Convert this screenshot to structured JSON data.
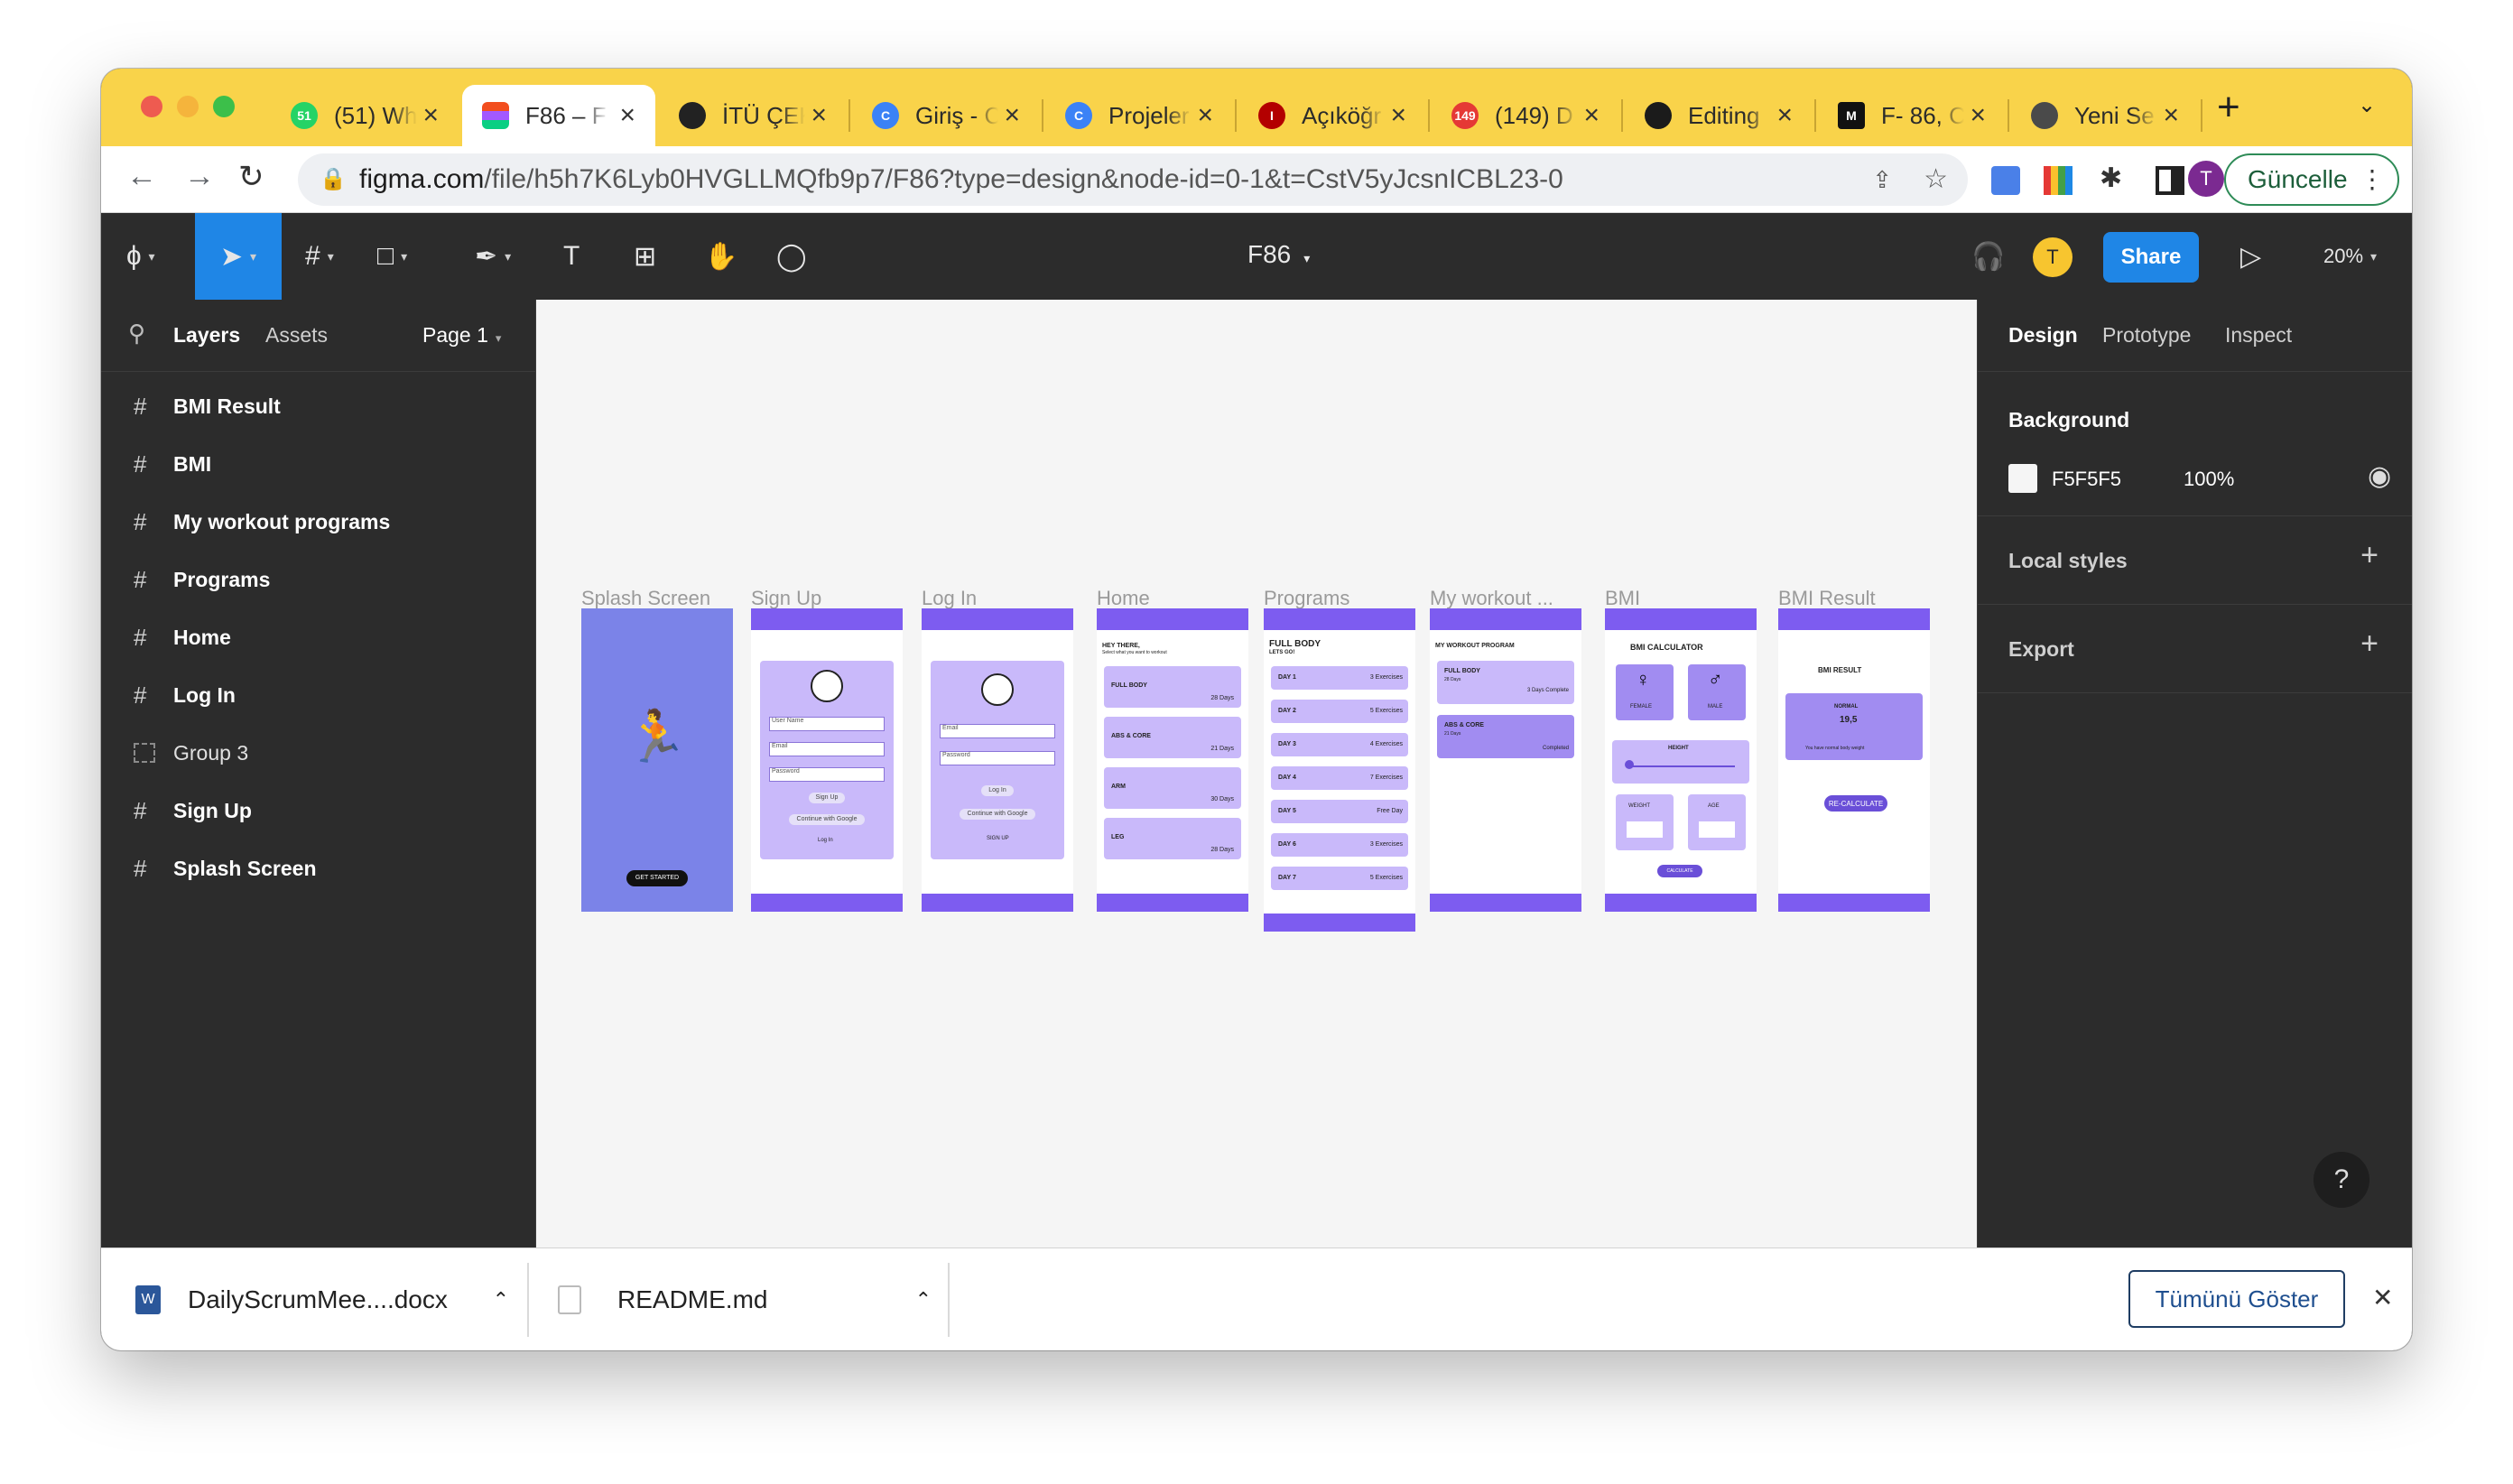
{
  "browser": {
    "tabs": [
      {
        "title": "(51) Wh",
        "icon": "whatsapp-icon",
        "color": "#25d366",
        "badge": "51"
      },
      {
        "title": "F86 – F",
        "icon": "figma-icon",
        "color": "#a259ff",
        "active": true
      },
      {
        "title": "İTÜ ÇEK",
        "icon": "globe-icon",
        "color": "#222222"
      },
      {
        "title": "Giriş - C",
        "icon": "c-logo-icon",
        "color": "#3b82f6"
      },
      {
        "title": "Projeler",
        "icon": "c-logo-icon",
        "color": "#3b82f6"
      },
      {
        "title": "Açıköğr",
        "icon": "aof-logo-icon",
        "color": "#b30000"
      },
      {
        "title": "(149) D",
        "icon": "youtube-badge-icon",
        "color": "#e53935",
        "badge": "149"
      },
      {
        "title": "Editing",
        "icon": "github-icon",
        "color": "#1b1b1b"
      },
      {
        "title": "F- 86, C",
        "icon": "miro-icon",
        "color": "#111111"
      },
      {
        "title": "Yeni Se",
        "icon": "chrome-icon",
        "color": "#4a4a4a"
      }
    ],
    "new_tab": "+",
    "url_host": "figma.com",
    "url_path": "/file/h5h7K6Lyb0HVGLLMQfb9p7/F86?type=design&node-id=0-1&t=CstV5yJcsnICBL23-0",
    "profile_initial": "T",
    "update_label": "Güncelle"
  },
  "figma": {
    "file_name": "F86",
    "user_initial": "T",
    "share_label": "Share",
    "zoom": "20%",
    "left_tabs": {
      "layers": "Layers",
      "assets": "Assets",
      "page": "Page 1"
    },
    "layers": [
      {
        "name": "BMI Result",
        "type": "frame"
      },
      {
        "name": "BMI",
        "type": "frame"
      },
      {
        "name": "My workout programs",
        "type": "frame"
      },
      {
        "name": "Programs",
        "type": "frame"
      },
      {
        "name": "Home",
        "type": "frame"
      },
      {
        "name": "Log In",
        "type": "frame"
      },
      {
        "name": "Group 3",
        "type": "group"
      },
      {
        "name": "Sign Up",
        "type": "frame"
      },
      {
        "name": "Splash Screen",
        "type": "frame"
      }
    ],
    "right_tabs": {
      "design": "Design",
      "prototype": "Prototype",
      "inspect": "Inspect"
    },
    "background": {
      "label": "Background",
      "hex": "F5F5F5",
      "opacity": "100%"
    },
    "local_styles": "Local styles",
    "export": "Export",
    "help": "?"
  },
  "frames": {
    "titles": [
      "Splash Screen",
      "Sign Up",
      "Log In",
      "Home",
      "Programs",
      "My workout ...",
      "BMI",
      "BMI Result"
    ],
    "splash_button": "GET STARTED",
    "signup": {
      "fields": [
        "User Name",
        "Email",
        "Password"
      ],
      "button": "Sign Up",
      "google": "Continue with Google",
      "link": "Log In"
    },
    "login": {
      "fields": [
        "Email",
        "Password"
      ],
      "button": "Log In",
      "google": "Continue with Google",
      "link": "SIGN UP"
    },
    "home": {
      "greeting": "HEY THERE,",
      "sub": "Select what you want to workout",
      "cards": [
        {
          "name": "FULL BODY",
          "days": "28 Days"
        },
        {
          "name": "ABS & CORE",
          "days": "21 Days"
        },
        {
          "name": "ARM",
          "days": "30 Days"
        },
        {
          "name": "LEG",
          "days": "28 Days"
        }
      ]
    },
    "programs": {
      "title": "FULL BODY",
      "sub": "LETS GO!",
      "days": [
        {
          "day": "DAY 1",
          "ex": "3 Exercises"
        },
        {
          "day": "DAY 2",
          "ex": "5 Exercises"
        },
        {
          "day": "DAY 3",
          "ex": "4 Exercises"
        },
        {
          "day": "DAY 4",
          "ex": "7 Exercises"
        },
        {
          "day": "DAY 5",
          "ex": "Free Day"
        },
        {
          "day": "DAY 6",
          "ex": "3 Exercises"
        },
        {
          "day": "DAY 7",
          "ex": "5 Exercises"
        }
      ]
    },
    "myworkout": {
      "title": "MY WORKOUT PROGRAM",
      "cards": [
        {
          "name": "FULL BODY",
          "days": "28 Days",
          "status": "3 Days Complete"
        },
        {
          "name": "ABS & CORE",
          "days": "21 Days",
          "status": "Completed"
        }
      ]
    },
    "bmi": {
      "title": "BMI CALCULATOR",
      "female": "FEMALE",
      "male": "MALE",
      "height": "HEIGHT",
      "weight": "WEIGHT",
      "age": "AGE",
      "button": "CALCULATE"
    },
    "bmiresult": {
      "title": "BMI RESULT",
      "status": "NORMAL",
      "value": "19,5",
      "note": "You have normal body weight",
      "button": "RE-CALCULATE"
    }
  },
  "downloads": {
    "items": [
      {
        "name": "DailyScrumMee....docx",
        "icon": "word-doc-icon"
      },
      {
        "name": "README.md",
        "icon": "file-icon"
      }
    ],
    "show_all": "Tümünü Göster",
    "close": "✕"
  },
  "colors": {
    "accent": "#7d5cf0",
    "figma_blue": "#1f86e6",
    "tabbar": "#f9d34a"
  }
}
